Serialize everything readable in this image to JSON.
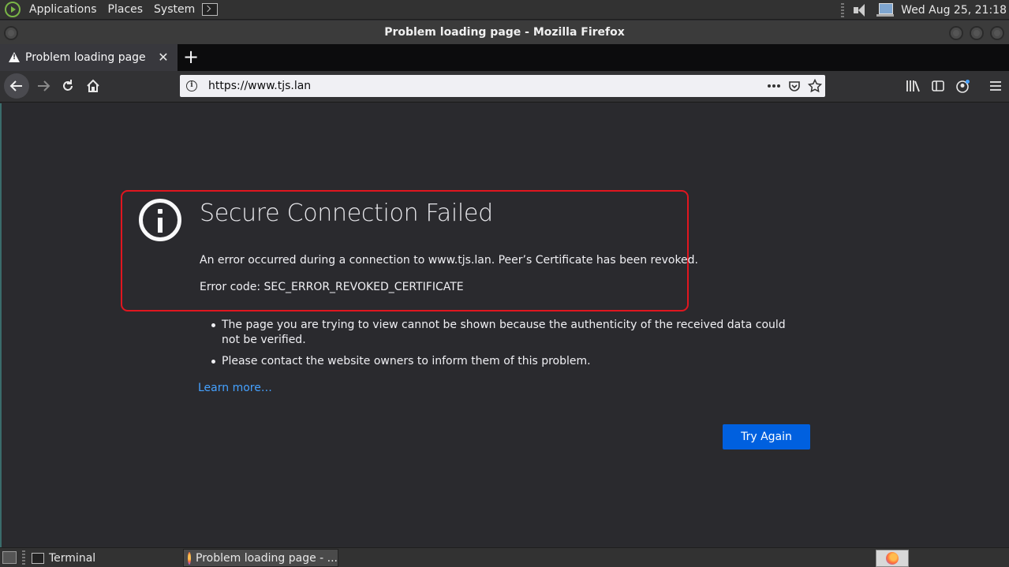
{
  "top_panel": {
    "menus": [
      "Applications",
      "Places",
      "System"
    ],
    "clock": "Wed Aug 25, 21:18"
  },
  "window": {
    "title": "Problem loading page - Mozilla Firefox"
  },
  "tabs": [
    {
      "label": "Problem loading page",
      "icon": "warning-icon"
    }
  ],
  "navbar": {
    "url": "https://www.tjs.lan"
  },
  "error_page": {
    "title": "Secure Connection Failed",
    "description": "An error occurred during a connection to www.tjs.lan. Peer’s Certificate has been revoked.",
    "error_code": "Error code: SEC_ERROR_REVOKED_CERTIFICATE",
    "bullets": [
      "The page you are trying to view cannot be shown because the authenticity of the received data could not be verified.",
      "Please contact the website owners to inform them of this problem."
    ],
    "learn_more": "Learn more…",
    "try_again": "Try Again",
    "highlight_color": "#e0161f",
    "button_color": "#0060df",
    "link_color": "#45a1ff"
  },
  "taskbar": {
    "tasks": [
      {
        "label": "Terminal",
        "icon": "terminal-icon"
      },
      {
        "label": "Problem loading page - ...",
        "icon": "firefox-icon"
      }
    ]
  }
}
